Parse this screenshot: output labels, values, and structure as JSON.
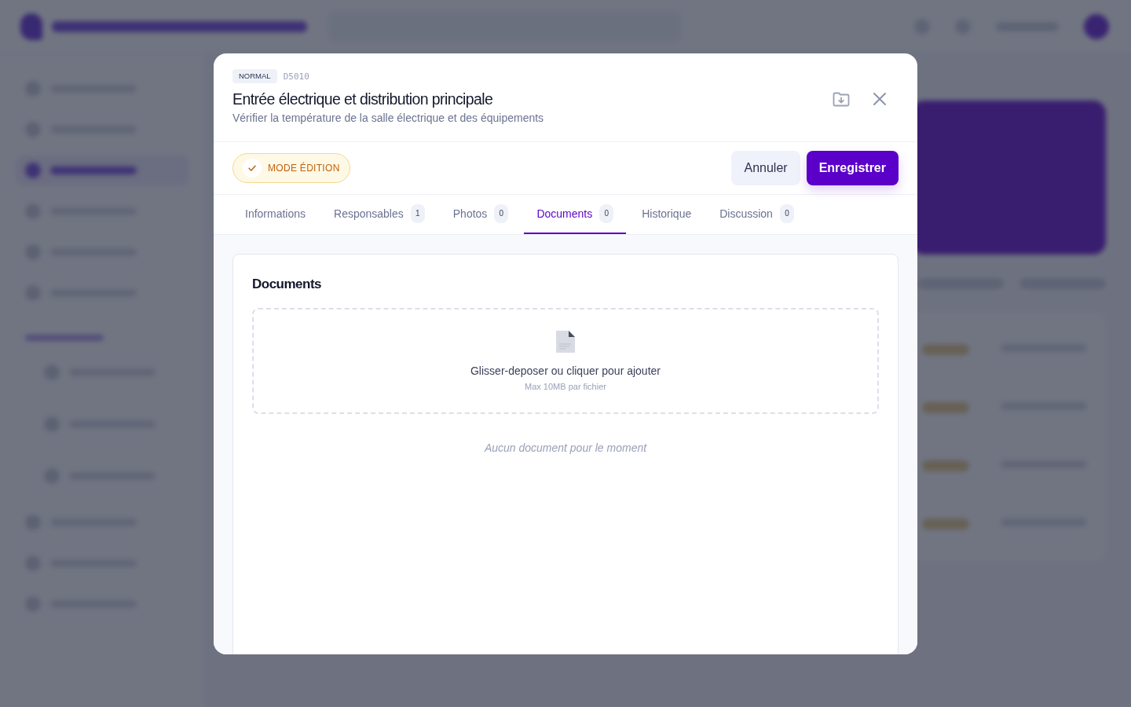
{
  "modal": {
    "priority_tag": "NORMAL",
    "code": "D5010",
    "title": "Entrée électrique et distribution principale",
    "subtitle": "Vérifier la température de la salle électrique et des équipements",
    "mode_badge": "MODE ÉDITION",
    "buttons": [
      {
        "label": "Annuler",
        "kind": "cancel"
      },
      {
        "label": "Enregistrer",
        "kind": "save"
      }
    ],
    "tabs": [
      {
        "label": "Informations",
        "selected": false
      },
      {
        "label": "Responsables",
        "count": "1",
        "selected": false
      },
      {
        "label": "Photos",
        "count": "0",
        "selected": false
      },
      {
        "label": "Documents",
        "count": "0",
        "selected": true
      },
      {
        "label": "Historique",
        "selected": false
      },
      {
        "label": "Discussion",
        "count": "0",
        "selected": false
      }
    ],
    "documents_panel": {
      "heading": "Documents",
      "dropzone": {
        "prompt": "Glisser-deposer ou cliquer pour ajouter",
        "hint": "Max 10MB par fichier"
      },
      "empty_message": "Aucun document pour le moment"
    }
  }
}
